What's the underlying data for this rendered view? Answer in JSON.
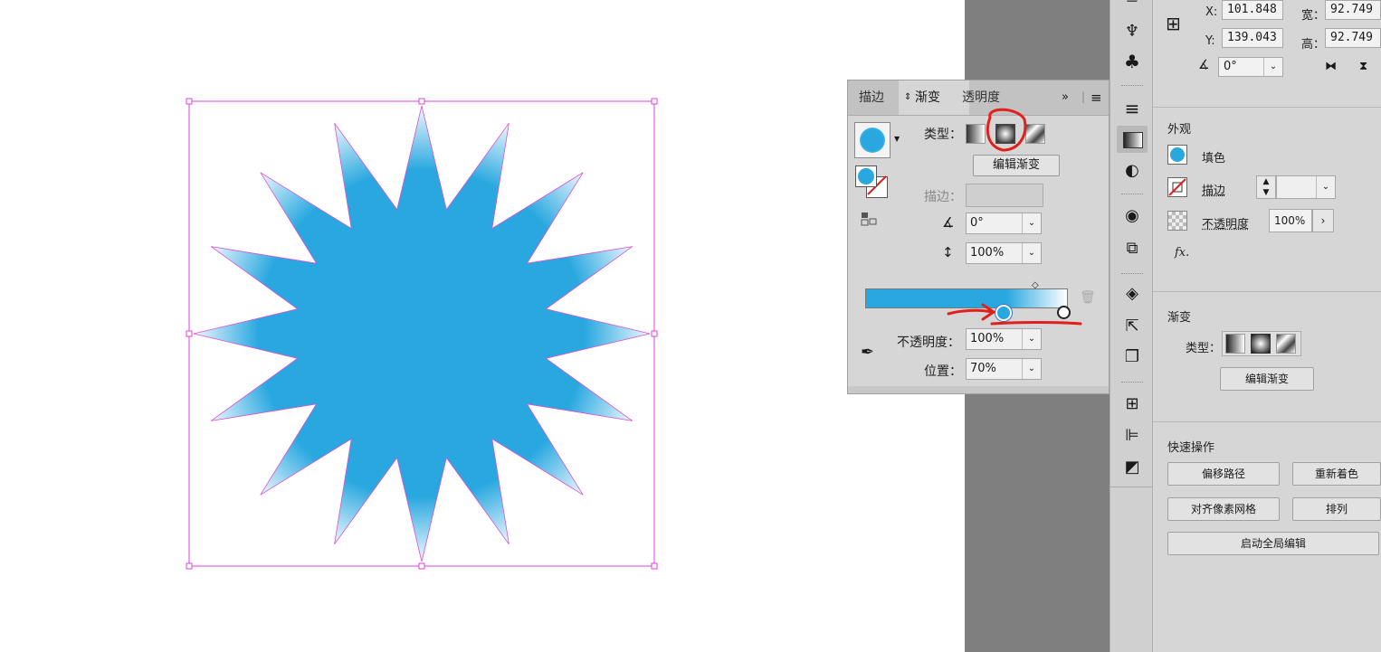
{
  "canvas": {
    "shape": "16-point star",
    "fill": "#29a8e0",
    "selection_color": "#e040e0"
  },
  "gradient_panel": {
    "tabs": [
      "描边",
      "渐变",
      "透明度"
    ],
    "active_tab": "渐变",
    "type_label": "类型：",
    "edit_gradient_label": "编辑渐变",
    "stroke_label": "描边：",
    "angle_value": "0°",
    "aspect_value": "100%",
    "opacity_label": "不透明度：",
    "opacity_value": "100%",
    "position_label": "位置：",
    "position_value": "70%",
    "gradient_start": "#29a8e0",
    "gradient_end": "#ffffff",
    "stop_position": 0.7
  },
  "properties": {
    "x_label": "X:",
    "x_value": "101.848",
    "y_label": "Y:",
    "y_value": "139.043",
    "w_label": "宽：",
    "w_value": "92.749",
    "h_label": "高：",
    "h_value": "92.749",
    "rotate_value": "0°",
    "appearance_title": "外观",
    "fill_label": "填色",
    "stroke_label": "描边",
    "opacity_label": "不透明度",
    "opacity_value": "100%",
    "fx_label": "fx.",
    "gradient_title": "渐变",
    "gradient_type_label": "类型：",
    "edit_gradient_label": "编辑渐变",
    "quick_actions_title": "快速操作",
    "offset_path": "偏移路径",
    "recolor": "重新着色",
    "align_pixel": "对齐像素网格",
    "arrange": "排列",
    "global_edit": "启动全局编辑"
  },
  "annotation_color": "#e0201c"
}
